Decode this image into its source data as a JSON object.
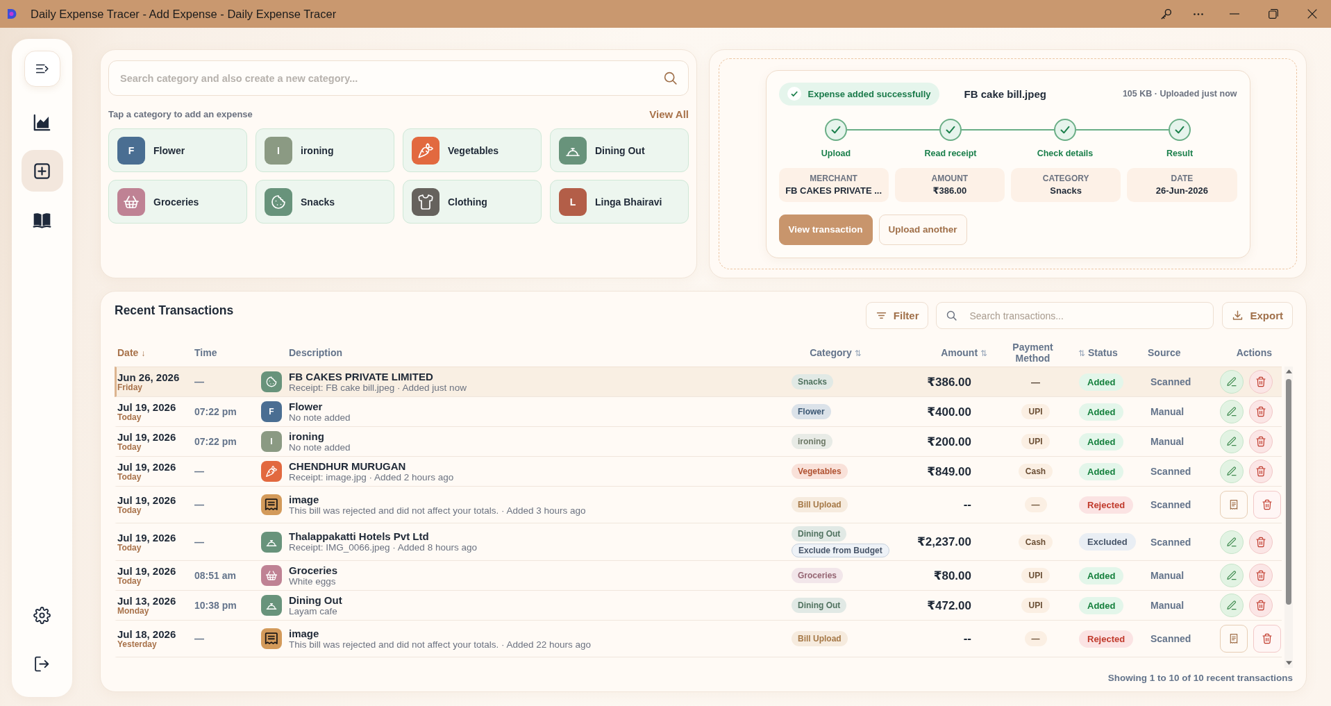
{
  "window": {
    "title": "Daily Expense Tracer - Add Expense - Daily Expense Tracer"
  },
  "sidebar": {
    "items": [
      {
        "selected": false
      },
      {
        "selected": true
      },
      {
        "selected": false
      }
    ]
  },
  "category_picker": {
    "search": {
      "placeholder": "Search category and also create a new category..."
    },
    "hint": "Tap a category to add an expense",
    "view_all": "View All",
    "categories": [
      {
        "name": "Flower",
        "kind": "letter",
        "letter": "F",
        "color": "#4a6e92"
      },
      {
        "name": "ironing",
        "kind": "letter",
        "letter": "I",
        "color": "#8b9a83"
      },
      {
        "name": "Vegetables",
        "kind": "carrot",
        "color": "#e2693f"
      },
      {
        "name": "Dining Out",
        "kind": "bell",
        "color": "#68937b"
      },
      {
        "name": "Groceries",
        "kind": "basket",
        "color": "#bf8294"
      },
      {
        "name": "Snacks",
        "kind": "cookie",
        "color": "#68937b"
      },
      {
        "name": "Clothing",
        "kind": "shirt",
        "color": "#66625d"
      },
      {
        "name": "Linga Bhairavi",
        "kind": "letter",
        "letter": "L",
        "color": "#b35e48"
      }
    ]
  },
  "upload_result": {
    "status": "Expense added successfully",
    "file_name": "FB cake bill.jpeg",
    "file_info": "105 KB · Uploaded just now",
    "steps": [
      {
        "label": "Upload",
        "done": true
      },
      {
        "label": "Read receipt",
        "done": true
      },
      {
        "label": "Check details",
        "done": true
      },
      {
        "label": "Result",
        "done": true
      }
    ],
    "fields": [
      {
        "label": "MERCHANT",
        "value": "FB CAKES PRIVATE ..."
      },
      {
        "label": "AMOUNT",
        "value": "₹386.00"
      },
      {
        "label": "CATEGORY",
        "value": "Snacks"
      },
      {
        "label": "DATE",
        "value": "26-Jun-2026"
      }
    ],
    "buttons": [
      {
        "label": "View transaction",
        "kind": "primary"
      },
      {
        "label": "Upload another",
        "kind": "secondary"
      }
    ]
  },
  "transactions": {
    "title": "Recent Transactions",
    "filter_button": "Filter",
    "search": {
      "placeholder": "Search transactions..."
    },
    "export_button": "Export",
    "columns": [
      {
        "label": "Date",
        "sort": "↓",
        "selected": true
      },
      {
        "label": "Time",
        "selected": false
      },
      {
        "label": "Description",
        "selected": false
      },
      {
        "label": "Category",
        "sort": "⇅",
        "selected": false
      },
      {
        "label": "Amount",
        "sort": "⇅",
        "selected": false
      },
      {
        "label": "Payment Method",
        "selected": false
      },
      {
        "label": "Status",
        "sort_lead": "⇅",
        "selected": false
      },
      {
        "label": "Source",
        "selected": false
      },
      {
        "label": "Actions",
        "selected": false
      }
    ],
    "rows": [
      {
        "date": "Jun 26, 2026",
        "day": "Friday",
        "time": "—",
        "icon": {
          "kind": "cookie",
          "color": "#68937b"
        },
        "title": "FB CAKES PRIVATE LIMITED",
        "note": "Receipt: FB cake bill.jpeg · Added just now",
        "category": "Snacks",
        "amount": "₹386.00",
        "payment": "—",
        "payment_pill": false,
        "status": {
          "label": "Added",
          "kind": "added"
        },
        "source": "Scanned",
        "kind": "expense",
        "selected": true
      },
      {
        "date": "Jul 19, 2026",
        "day": "Today",
        "time": "07:22 pm",
        "icon": {
          "kind": "letter",
          "letter": "F",
          "color": "#4a6e92"
        },
        "title": "Flower",
        "note": "No note added",
        "category": "Flower",
        "amount": "₹400.00",
        "payment": "UPI",
        "payment_pill": true,
        "status": {
          "label": "Added",
          "kind": "added"
        },
        "source": "Manual",
        "kind": "expense",
        "selected": false
      },
      {
        "date": "Jul 19, 2026",
        "day": "Today",
        "time": "07:22 pm",
        "icon": {
          "kind": "letter",
          "letter": "I",
          "color": "#8b9a83"
        },
        "title": "ironing",
        "note": "No note added",
        "category": "ironing",
        "amount": "₹200.00",
        "payment": "UPI",
        "payment_pill": true,
        "status": {
          "label": "Added",
          "kind": "added"
        },
        "source": "Manual",
        "kind": "expense",
        "selected": false
      },
      {
        "date": "Jul 19, 2026",
        "day": "Today",
        "time": "—",
        "icon": {
          "kind": "carrot",
          "color": "#e2693f"
        },
        "title": "CHENDHUR MURUGAN",
        "note": "Receipt: image.jpg · Added 2 hours ago",
        "category": "Vegetables",
        "amount": "₹849.00",
        "payment": "Cash",
        "payment_pill": true,
        "status": {
          "label": "Added",
          "kind": "added"
        },
        "source": "Scanned",
        "kind": "expense",
        "selected": false
      },
      {
        "date": "Jul 19, 2026",
        "day": "Today",
        "time": "—",
        "icon": {
          "kind": "receipt",
          "color": "#d39a5a"
        },
        "title": "image",
        "note": "This bill was rejected and did not affect your totals. · Added 3 hours ago",
        "category": "Bill Upload",
        "amount": "--",
        "payment": "—",
        "payment_pill": true,
        "status": {
          "label": "Rejected",
          "kind": "rejected"
        },
        "source": "Scanned",
        "kind": "rejected",
        "selected": false
      },
      {
        "date": "Jul 19, 2026",
        "day": "Today",
        "time": "—",
        "icon": {
          "kind": "bell",
          "color": "#68937b"
        },
        "title": "Thalappakatti Hotels Pvt Ltd",
        "note": "Receipt: IMG_0066.jpeg · Added 8 hours ago",
        "category": "Dining Out",
        "flag": "Exclude from Budget",
        "amount": "₹2,237.00",
        "payment": "Cash",
        "payment_pill": true,
        "status": {
          "label": "Excluded",
          "kind": "excluded"
        },
        "source": "Scanned",
        "kind": "expense",
        "selected": false
      },
      {
        "date": "Jul 19, 2026",
        "day": "Today",
        "time": "08:51 am",
        "icon": {
          "kind": "basket",
          "color": "#bf8294"
        },
        "title": "Groceries",
        "note": "White eggs",
        "category": "Groceries",
        "amount": "₹80.00",
        "payment": "UPI",
        "payment_pill": true,
        "status": {
          "label": "Added",
          "kind": "added"
        },
        "source": "Manual",
        "kind": "expense",
        "selected": false
      },
      {
        "date": "Jul 13, 2026",
        "day": "Monday",
        "time": "10:38 pm",
        "icon": {
          "kind": "bell",
          "color": "#68937b"
        },
        "title": "Dining Out",
        "note": "Layam cafe",
        "category": "Dining Out",
        "amount": "₹472.00",
        "payment": "UPI",
        "payment_pill": true,
        "status": {
          "label": "Added",
          "kind": "added"
        },
        "source": "Manual",
        "kind": "expense",
        "selected": false
      },
      {
        "date": "Jul 18, 2026",
        "day": "Yesterday",
        "time": "—",
        "icon": {
          "kind": "receipt",
          "color": "#d39a5a"
        },
        "title": "image",
        "note": "This bill was rejected and did not affect your totals. · Added 22 hours ago",
        "category": "Bill Upload",
        "amount": "--",
        "payment": "—",
        "payment_pill": true,
        "status": {
          "label": "Rejected",
          "kind": "rejected"
        },
        "source": "Scanned",
        "kind": "rejected",
        "selected": false
      }
    ],
    "footer": "Showing 1 to 10 of 10 recent transactions"
  }
}
